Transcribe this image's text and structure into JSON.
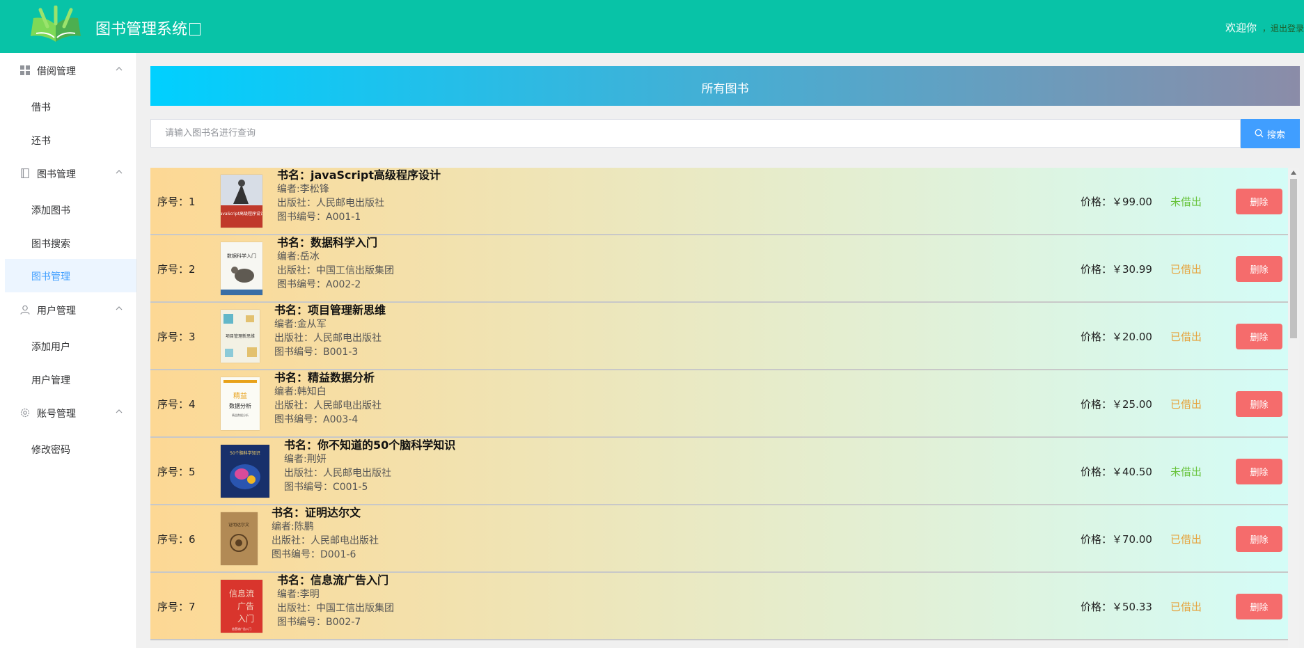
{
  "app": {
    "title": "图书管理系统",
    "welcome_text": "欢迎你",
    "logout_link": "，退出登录",
    "colors": {
      "topbar": "#08c3a7",
      "accent": "#409eff",
      "danger": "#f56c6c",
      "available": "#67c23a",
      "borrowed": "#e6a23c"
    }
  },
  "sidebar": {
    "groups": [
      {
        "label": "借阅管理",
        "icon": "grid-icon",
        "items": [
          "借书",
          "还书"
        ]
      },
      {
        "label": "图书管理",
        "icon": "notebook-icon",
        "items": [
          "添加图书",
          "图书搜索",
          "图书管理"
        ]
      },
      {
        "label": "用户管理",
        "icon": "user-icon",
        "items": [
          "添加用户",
          "用户管理"
        ]
      },
      {
        "label": "账号管理",
        "icon": "gear-icon",
        "items": [
          "修改密码"
        ]
      }
    ],
    "active_item": "图书管理"
  },
  "page": {
    "banner_title": "所有图书",
    "search_placeholder": "请输入图书名进行查询",
    "search_button": "搜索",
    "delete_label": "删除"
  },
  "books": [
    {
      "index": "序号：1",
      "name": "书名：javaScript高级程序设计",
      "author": "编者:李松锋",
      "publisher": "出版社：人民邮电出版社",
      "code": "图书编号：A001-1",
      "price": "价格：￥99.00",
      "status": "未借出"
    },
    {
      "index": "序号：2",
      "name": "书名：数据科学入门",
      "author": "编者:岳冰",
      "publisher": "出版社：中国工信出版集团",
      "code": "图书编号：A002-2",
      "price": "价格：￥30.99",
      "status": "已借出"
    },
    {
      "index": "序号：3",
      "name": "书名：项目管理新思维",
      "author": "编者:金从军",
      "publisher": "出版社：人民邮电出版社",
      "code": "图书编号：B001-3",
      "price": "价格：￥20.00",
      "status": "已借出"
    },
    {
      "index": "序号：4",
      "name": "书名：精益数据分析",
      "author": "编者:韩知白",
      "publisher": "出版社：人民邮电出版社",
      "code": "图书编号：A003-4",
      "price": "价格：￥25.00",
      "status": "已借出"
    },
    {
      "index": "序号：5",
      "name": "书名：你不知道的50个脑科学知识",
      "author": "编者:荆妍",
      "publisher": "出版社：人民邮电出版社",
      "code": "图书编号：C001-5",
      "price": "价格：￥40.50",
      "status": "未借出"
    },
    {
      "index": "序号：6",
      "name": "书名：证明达尔文",
      "author": "编者:陈鹏",
      "publisher": "出版社：人民邮电出版社",
      "code": "图书编号：D001-6",
      "price": "价格：￥70.00",
      "status": "已借出"
    },
    {
      "index": "序号：7",
      "name": "书名：信息流广告入门",
      "author": "编者:李明",
      "publisher": "出版社：中国工信出版集团",
      "code": "图书编号：B002-7",
      "price": "价格：￥50.33",
      "status": "已借出"
    }
  ],
  "covers": [
    {
      "title": "JavaScript高级程序设计",
      "bg": "#d7dde6",
      "accent": "#c0392b"
    },
    {
      "title": "数据科学入门",
      "bg": "#f7f7f2",
      "accent": "#5f5a52"
    },
    {
      "title": "项目管理新思维",
      "bg": "#f3f1e4",
      "accent": "#63b7c9"
    },
    {
      "title": "精益数据分析",
      "bg": "#fbfbf5",
      "accent": "#e8a21a"
    },
    {
      "title": "50个脑科学知识",
      "bg": "#18306b",
      "accent": "#d84b9a"
    },
    {
      "title": "证明达尔文",
      "bg": "#b28a55",
      "accent": "#5a3f22"
    },
    {
      "title": "信息流广告入门",
      "bg": "#d9352d",
      "accent": "#f2d3c0"
    }
  ]
}
